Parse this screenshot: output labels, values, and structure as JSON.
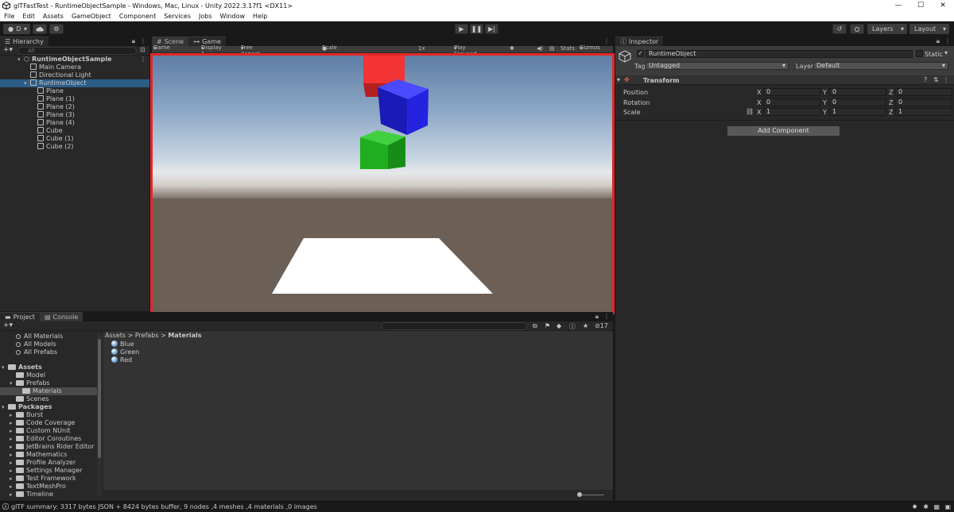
{
  "window": {
    "title": "glTFastTest - RuntimeObjectSample - Windows, Mac, Linux - Unity 2022.3.17f1 <DX11>",
    "minimize": "—",
    "maximize": "☐",
    "close": "✕"
  },
  "menu": [
    "File",
    "Edit",
    "Assets",
    "GameObject",
    "Component",
    "Services",
    "Jobs",
    "Window",
    "Help"
  ],
  "toolbar": {
    "account": "D",
    "layers": "Layers",
    "layout": "Layout"
  },
  "hierarchy": {
    "tab": "Hierarchy",
    "search_placeholder": "All",
    "scene": "RuntimeObjectSample",
    "items": [
      {
        "label": "Main Camera"
      },
      {
        "label": "Directional Light"
      },
      {
        "label": "RuntimeObject"
      },
      {
        "label": "Plane"
      },
      {
        "label": "Plane (1)"
      },
      {
        "label": "Plane (2)"
      },
      {
        "label": "Plane (3)"
      },
      {
        "label": "Plane (4)"
      },
      {
        "label": "Cube"
      },
      {
        "label": "Cube (1)"
      },
      {
        "label": "Cube (2)"
      }
    ]
  },
  "game": {
    "tabs": [
      {
        "label": "Scene"
      },
      {
        "label": "Game"
      }
    ],
    "header": {
      "mode": "Game",
      "display": "Display 1",
      "aspect": "Free Aspect",
      "scale_label": "Scale",
      "scale_value": "1x",
      "play_focused": "Play Focused",
      "stats": "Stats",
      "gizmos": "Gizmos"
    },
    "colors": {
      "red_cube": "#f23434",
      "blue_cube": "#2323e0",
      "green_cube": "#1fae1f",
      "plane": "#ffffff",
      "frame_border": "#e32626"
    }
  },
  "project": {
    "tabs": [
      {
        "label": "Project"
      },
      {
        "label": "Console"
      }
    ],
    "hidden_count": "17",
    "favorites": [
      {
        "label": "All Materials"
      },
      {
        "label": "All Models"
      },
      {
        "label": "All Prefabs"
      }
    ],
    "assets_root": "Assets",
    "assets": [
      {
        "label": "Model"
      },
      {
        "label": "Prefabs"
      },
      {
        "label": "Materials"
      },
      {
        "label": "Scenes"
      }
    ],
    "packages_root": "Packages",
    "packages": [
      {
        "label": "Burst"
      },
      {
        "label": "Code Coverage"
      },
      {
        "label": "Custom NUnit"
      },
      {
        "label": "Editor Coroutines"
      },
      {
        "label": "JetBrains Rider Editor"
      },
      {
        "label": "Mathematics"
      },
      {
        "label": "Profile Analyzer"
      },
      {
        "label": "Settings Manager"
      },
      {
        "label": "Test Framework"
      },
      {
        "label": "TextMeshPro"
      },
      {
        "label": "Timeline"
      }
    ],
    "breadcrumb": [
      "Assets",
      "Prefabs",
      "Materials"
    ],
    "breadcrumb_sep": ">",
    "materials": [
      {
        "label": "Blue"
      },
      {
        "label": "Green"
      },
      {
        "label": "Red"
      }
    ]
  },
  "inspector": {
    "tab": "Inspector",
    "object_name": "RuntimeObject",
    "static_label": "Static",
    "tag_label": "Tag",
    "tag_value": "Untagged",
    "layer_label": "Layer",
    "layer_value": "Default",
    "component": "Transform",
    "rows": [
      {
        "label": "Position",
        "x": "0",
        "y": "0",
        "z": "0"
      },
      {
        "label": "Rotation",
        "x": "0",
        "y": "0",
        "z": "0"
      },
      {
        "label": "Scale",
        "x": "1",
        "y": "1",
        "z": "1"
      }
    ],
    "axis": {
      "x": "X",
      "y": "Y",
      "z": "Z"
    },
    "add_component": "Add Component"
  },
  "status": {
    "message": "glTF summary: 3317 bytes JSON + 8424 bytes buffer, 9 nodes ,4 meshes ,4 materials ,0 images"
  }
}
